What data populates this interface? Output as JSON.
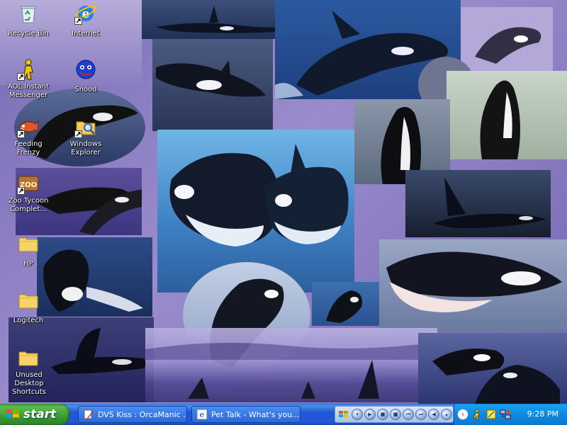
{
  "desktop": {
    "icons": [
      {
        "label": "Recycle Bin",
        "icon": "recycle-bin-icon",
        "shortcut": false
      },
      {
        "label": "Internet",
        "icon": "internet-explorer-icon",
        "shortcut": true
      },
      {
        "label": "AOL Instant Messenger",
        "icon": "aol-messenger-icon",
        "shortcut": true
      },
      {
        "label": "Snood",
        "icon": "snood-icon",
        "shortcut": false
      },
      {
        "label": "Feeding Frenzy",
        "icon": "feeding-frenzy-icon",
        "shortcut": true
      },
      {
        "label": "Windows Explorer",
        "icon": "windows-explorer-icon",
        "shortcut": true
      },
      {
        "label": "Zoo Tycoon Complet...",
        "icon": "zoo-tycoon-icon",
        "shortcut": true
      },
      {
        "label": "HP",
        "icon": "folder-icon",
        "shortcut": false
      },
      {
        "label": "Logitech",
        "icon": "folder-icon",
        "shortcut": false
      },
      {
        "label": "Unused Desktop Shortcuts",
        "icon": "folder-icon",
        "shortcut": false
      }
    ]
  },
  "taskbar": {
    "start_label": "start",
    "tasks": [
      {
        "label": "DVS Kiss : OrcaManic ...",
        "icon": "pen-document-icon"
      },
      {
        "label": "Pet Talk - What's you...",
        "icon": "internet-explorer-icon"
      }
    ],
    "clock": "9:28 PM",
    "colors": {
      "taskbar": "#2157d7",
      "start": "#3b9b36",
      "tray": "#0f89e0"
    }
  }
}
